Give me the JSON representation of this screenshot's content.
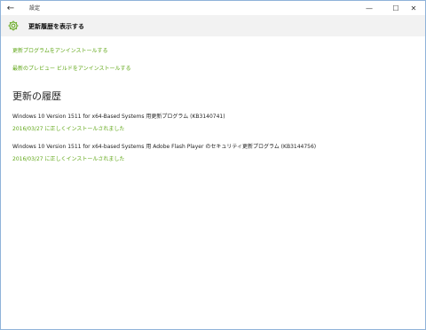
{
  "window": {
    "app_title": "設定",
    "controls": {
      "minimize": "—",
      "maximize": "☐",
      "close": "✕",
      "back": "←"
    }
  },
  "header": {
    "title": "更新履歴を表示する",
    "icon": "gear-icon"
  },
  "links": {
    "uninstall_updates": "更新プログラムをアンインストールする",
    "uninstall_preview": "最新のプレビュー ビルドをアンインストールする"
  },
  "history": {
    "heading": "更新の履歴",
    "items": [
      {
        "title": "Windows 10 Version 1511 for x64-Based Systems 用更新プログラム (KB3140741)",
        "status": "2016/03/27 に正しくインストールされました"
      },
      {
        "title": "Windows 10 Version 1511 for x64-based Systems 用 Adobe Flash Player のセキュリティ更新プログラム (KB3144756)",
        "status": "2016/03/27 に正しくインストールされました"
      }
    ]
  },
  "colors": {
    "accent": "#62a81a",
    "header_band": "#f2f2f2",
    "window_border": "#8fb3d9"
  }
}
